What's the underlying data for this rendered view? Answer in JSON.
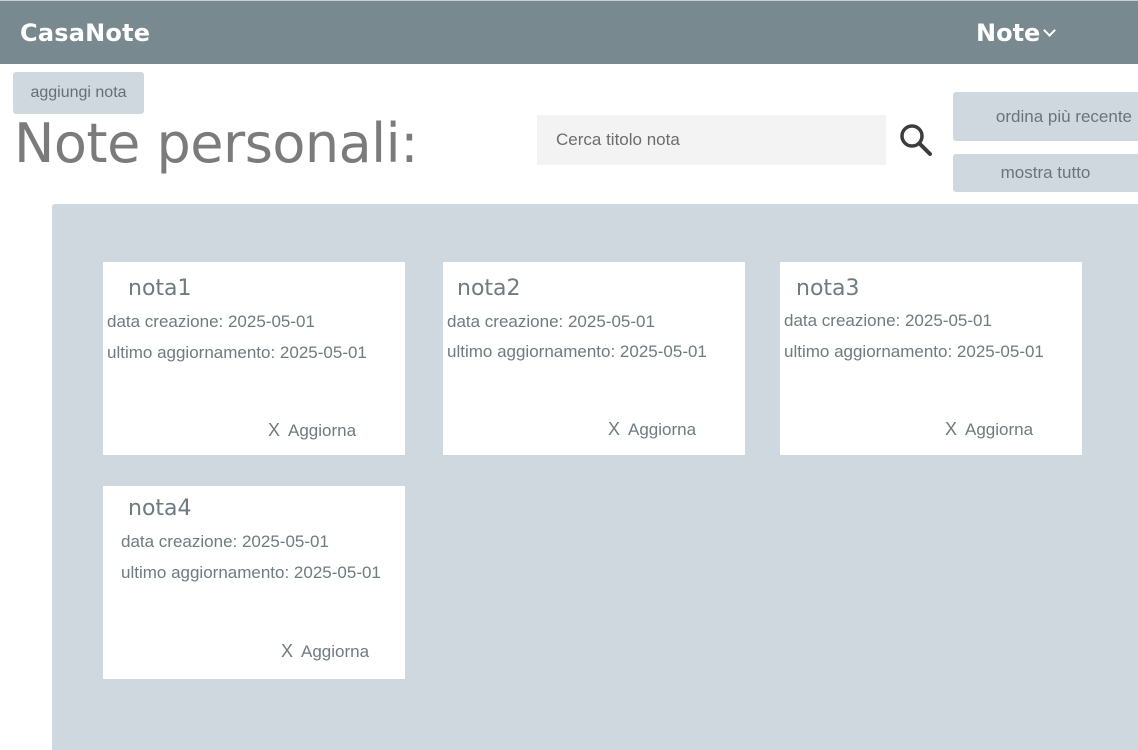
{
  "header": {
    "brand": "CasaNote",
    "menu_label": "Note"
  },
  "toolbar": {
    "add_label": "aggiungi nota",
    "page_title": "Note personali:",
    "search_placeholder": "Cerca titolo nota",
    "search_icon": "search-icon",
    "sort_label": "ordina più recente",
    "show_all_label": "mostra tutto"
  },
  "notes": [
    {
      "title": "nota1",
      "created": "data creazione: 2025-05-01",
      "updated": "ultimo aggiornamento: 2025-05-01",
      "delete_label": "X",
      "update_label": "Aggiorna"
    },
    {
      "title": "nota2",
      "created": "data creazione: 2025-05-01",
      "updated": "ultimo aggiornamento: 2025-05-01",
      "delete_label": "X",
      "update_label": "Aggiorna"
    },
    {
      "title": "nota3",
      "created": "data creazione: 2025-05-01",
      "updated": "ultimo aggiornamento: 2025-05-01",
      "delete_label": "X",
      "update_label": "Aggiorna"
    },
    {
      "title": "nota4",
      "created": "data creazione: 2025-05-01",
      "updated": "ultimo aggiornamento: 2025-05-01",
      "delete_label": "X",
      "update_label": "Aggiorna"
    }
  ],
  "colors": {
    "header_bg": "#788a8f",
    "panel_bg": "#cfd8de",
    "text_muted": "#6e7b80"
  }
}
